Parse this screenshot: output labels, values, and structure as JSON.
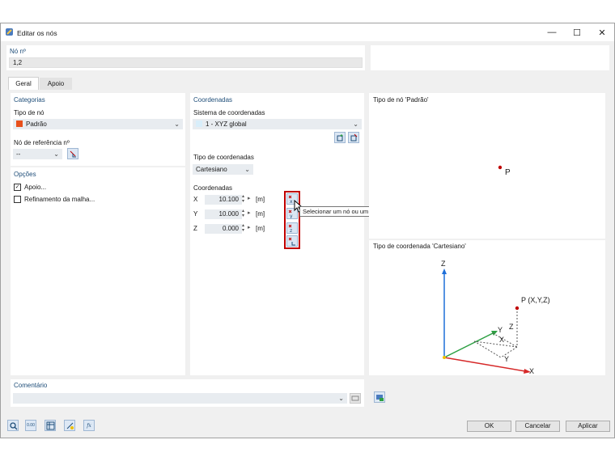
{
  "window": {
    "title": "Editar os nós",
    "minimize": "—",
    "maximize": "☐",
    "close": "✕"
  },
  "node": {
    "label": "Nó nº",
    "value": "1,2"
  },
  "tabs": [
    {
      "label": "Geral"
    },
    {
      "label": "Apoio"
    }
  ],
  "categories": {
    "title": "Categorias",
    "node_type_label": "Tipo de nó",
    "node_type_value": "Padrão",
    "node_type_color": "#e8501b",
    "ref_node_label": "Nó de referência nº",
    "ref_node_value": "--"
  },
  "options": {
    "title": "Opções",
    "items": [
      {
        "label": "Apoio...",
        "checked": true
      },
      {
        "label": "Refinamento da malha...",
        "checked": false
      }
    ]
  },
  "coordinates": {
    "title": "Coordenadas",
    "system_label": "Sistema de coordenadas",
    "system_value": "1 - XYZ global",
    "type_label": "Tipo de coordenadas",
    "type_value": "Cartesiano",
    "coords_label": "Coordenadas",
    "rows": [
      {
        "axis": "X",
        "value": "10.100",
        "unit": "[m]"
      },
      {
        "axis": "Y",
        "value": "10.000",
        "unit": "[m]"
      },
      {
        "axis": "Z",
        "value": "0.000",
        "unit": "[m]"
      }
    ],
    "tooltip": "Selecionar um nó ou um ponto no gráfico e importar a sua coordenada X"
  },
  "preview_node": {
    "title": "Tipo de nó 'Padrão'",
    "point_label": "P"
  },
  "preview_coord": {
    "title": "Tipo de coordenada 'Cartesiano'",
    "point_label": "P (X,Y,Z)",
    "axis_x": "X",
    "axis_y": "Y",
    "axis_z": "Z",
    "dim_x": "X",
    "dim_y": "Y",
    "dim_z": "Z"
  },
  "comment": {
    "label": "Comentário",
    "value": ""
  },
  "buttons": {
    "ok": "OK",
    "cancel": "Cancelar",
    "apply": "Aplicar"
  },
  "colors": {
    "accent_blue": "#1f4e79",
    "highlight_red": "#c00000",
    "axis_blue": "#1e6fd9",
    "axis_green": "#2ea043",
    "axis_red": "#d62828",
    "point_red": "#c00000"
  }
}
